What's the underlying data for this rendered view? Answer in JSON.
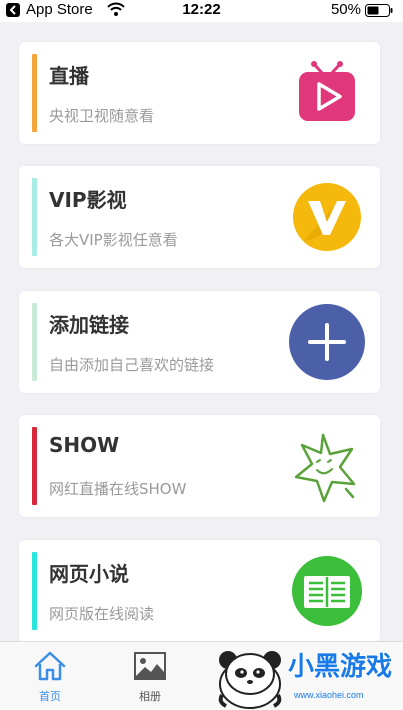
{
  "status_bar": {
    "carrier": "App Store",
    "time": "12:22",
    "battery": "50%"
  },
  "cards": [
    {
      "title": "直播",
      "subtitle": "央视卫视随意看",
      "accent": "#f3a73b",
      "icon": "tv-play-icon"
    },
    {
      "title": "VIP影视",
      "subtitle": "各大VIP影视任意看",
      "accent": "#a8ece6",
      "icon": "vip-v-icon"
    },
    {
      "title": "添加链接",
      "subtitle": "自由添加自己喜欢的链接",
      "accent": "#c9ead7",
      "icon": "plus-circle-icon"
    },
    {
      "title": "SHOW",
      "subtitle": "网红直播在线SHOW",
      "accent": "#d5283b",
      "icon": "star-smile-icon"
    },
    {
      "title": "网页小说",
      "subtitle": "网页版在线阅读",
      "accent": "#28e6dc",
      "icon": "book-icon"
    }
  ],
  "tabs": [
    {
      "label": "首页",
      "icon": "home-icon",
      "active": true
    },
    {
      "label": "相册",
      "icon": "album-icon",
      "active": false
    }
  ],
  "watermark": {
    "brand": "小黑游戏",
    "url": "www.xiaohei.com"
  }
}
